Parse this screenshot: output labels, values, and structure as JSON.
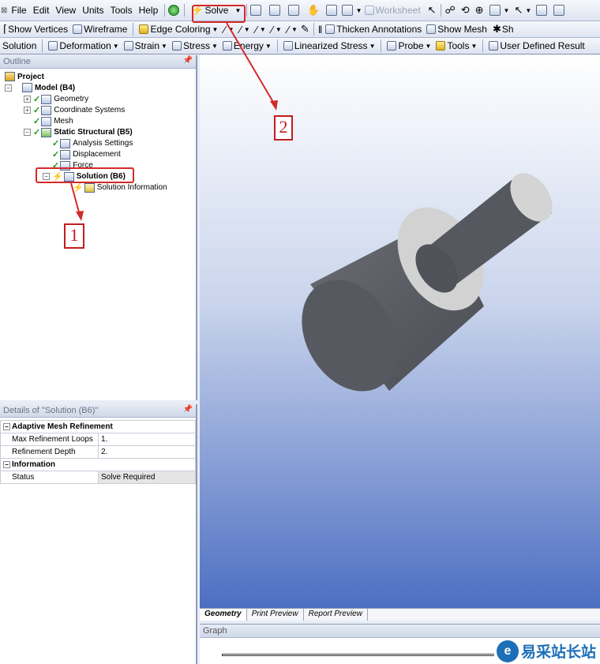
{
  "menu": [
    "File",
    "Edit",
    "View",
    "Units",
    "Tools",
    "Help"
  ],
  "toolbar1": {
    "solve_label": "Solve",
    "worksheet_label": "Worksheet"
  },
  "toolbar2": {
    "show_vertices": "Show Vertices",
    "wireframe": "Wireframe",
    "edge_coloring": "Edge Coloring",
    "thicken_annotations": "Thicken Annotations",
    "show_mesh": "Show Mesh",
    "truncated": "Sh"
  },
  "toolbar3": {
    "solution": "Solution",
    "deformation": "Deformation",
    "strain": "Strain",
    "stress": "Stress",
    "energy": "Energy",
    "linearized_stress": "Linearized Stress",
    "probe": "Probe",
    "tools": "Tools",
    "user_defined_result": "User Defined Result"
  },
  "outline": {
    "title": "Outline",
    "tree": {
      "project": "Project",
      "model": "Model (B4)",
      "geometry": "Geometry",
      "coordinate_systems": "Coordinate Systems",
      "mesh": "Mesh",
      "static_structural": "Static Structural (B5)",
      "analysis_settings": "Analysis Settings",
      "displacement": "Displacement",
      "force": "Force",
      "solution": "Solution (B6)",
      "solution_information": "Solution Information"
    }
  },
  "details": {
    "title": "Details of \"Solution (B6)\"",
    "groups": {
      "adaptive": "Adaptive Mesh Refinement",
      "information": "Information"
    },
    "rows": {
      "max_refinement_loops_label": "Max Refinement Loops",
      "max_refinement_loops_value": "1.",
      "refinement_depth_label": "Refinement Depth",
      "refinement_depth_value": "2.",
      "status_label": "Status",
      "status_value": "Solve Required"
    }
  },
  "viewport_tabs": [
    "Geometry",
    "Print Preview",
    "Report Preview"
  ],
  "graph": {
    "title": "Graph"
  },
  "annotations": {
    "label1": "1",
    "label2": "2"
  },
  "watermark": {
    "text": "易采站长站"
  },
  "colors": {
    "annotation_red": "#d42a2a",
    "model_gray": "#5a5d63",
    "face_light": "#d4d4d4"
  }
}
